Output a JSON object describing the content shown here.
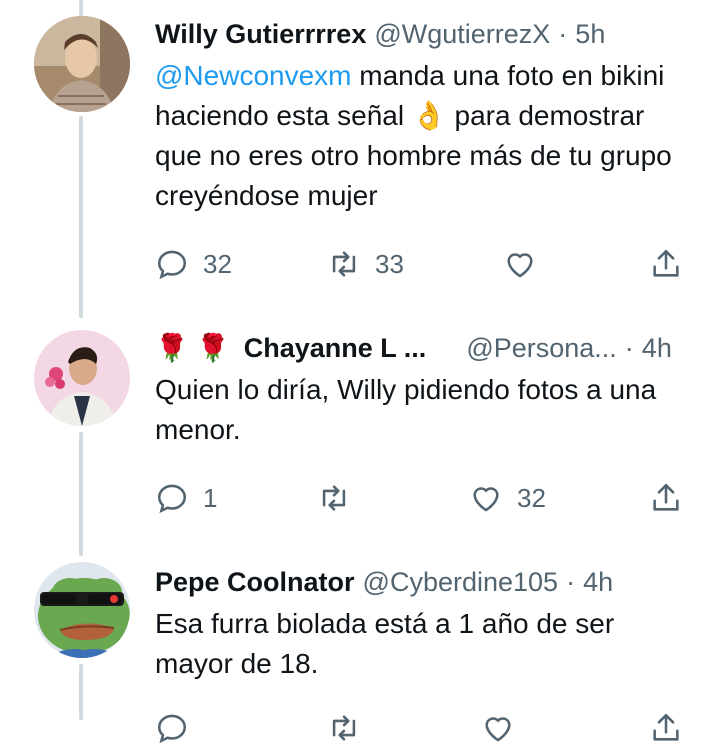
{
  "tweets": [
    {
      "name": "Willy Gutierrrrex",
      "handle": "@WgutierrezX",
      "sep": "·",
      "time": "5h",
      "mention": "@Newconvexm",
      "text_a": " manda una foto en bikini haciendo esta señal ",
      "emoji": "👌",
      "text_b": " para demostrar que no eres otro hombre más de tu grupo creyéndose mujer",
      "actions": {
        "reply": "32",
        "retweet": "33",
        "like": ""
      }
    },
    {
      "name_prefix": "🌹 🌹",
      "name": "Chayanne L ...",
      "handle": "@Persona...",
      "sep": "·",
      "time": "4h",
      "text": "Quien lo diría, Willy pidiendo fotos a una menor.",
      "actions": {
        "reply": "1",
        "retweet": "",
        "like": "32"
      }
    },
    {
      "name": "Pepe Coolnator",
      "handle": "@Cyberdine105",
      "sep": "·",
      "time": "4h",
      "text": "Esa furra biolada está a 1 año de ser mayor de 18.",
      "actions": {
        "reply": "",
        "retweet": "",
        "like": ""
      }
    }
  ],
  "colors": {
    "link": "#1d9bf0",
    "muted": "#536471",
    "thread": "#cfd9de",
    "text": "#0f1419"
  }
}
